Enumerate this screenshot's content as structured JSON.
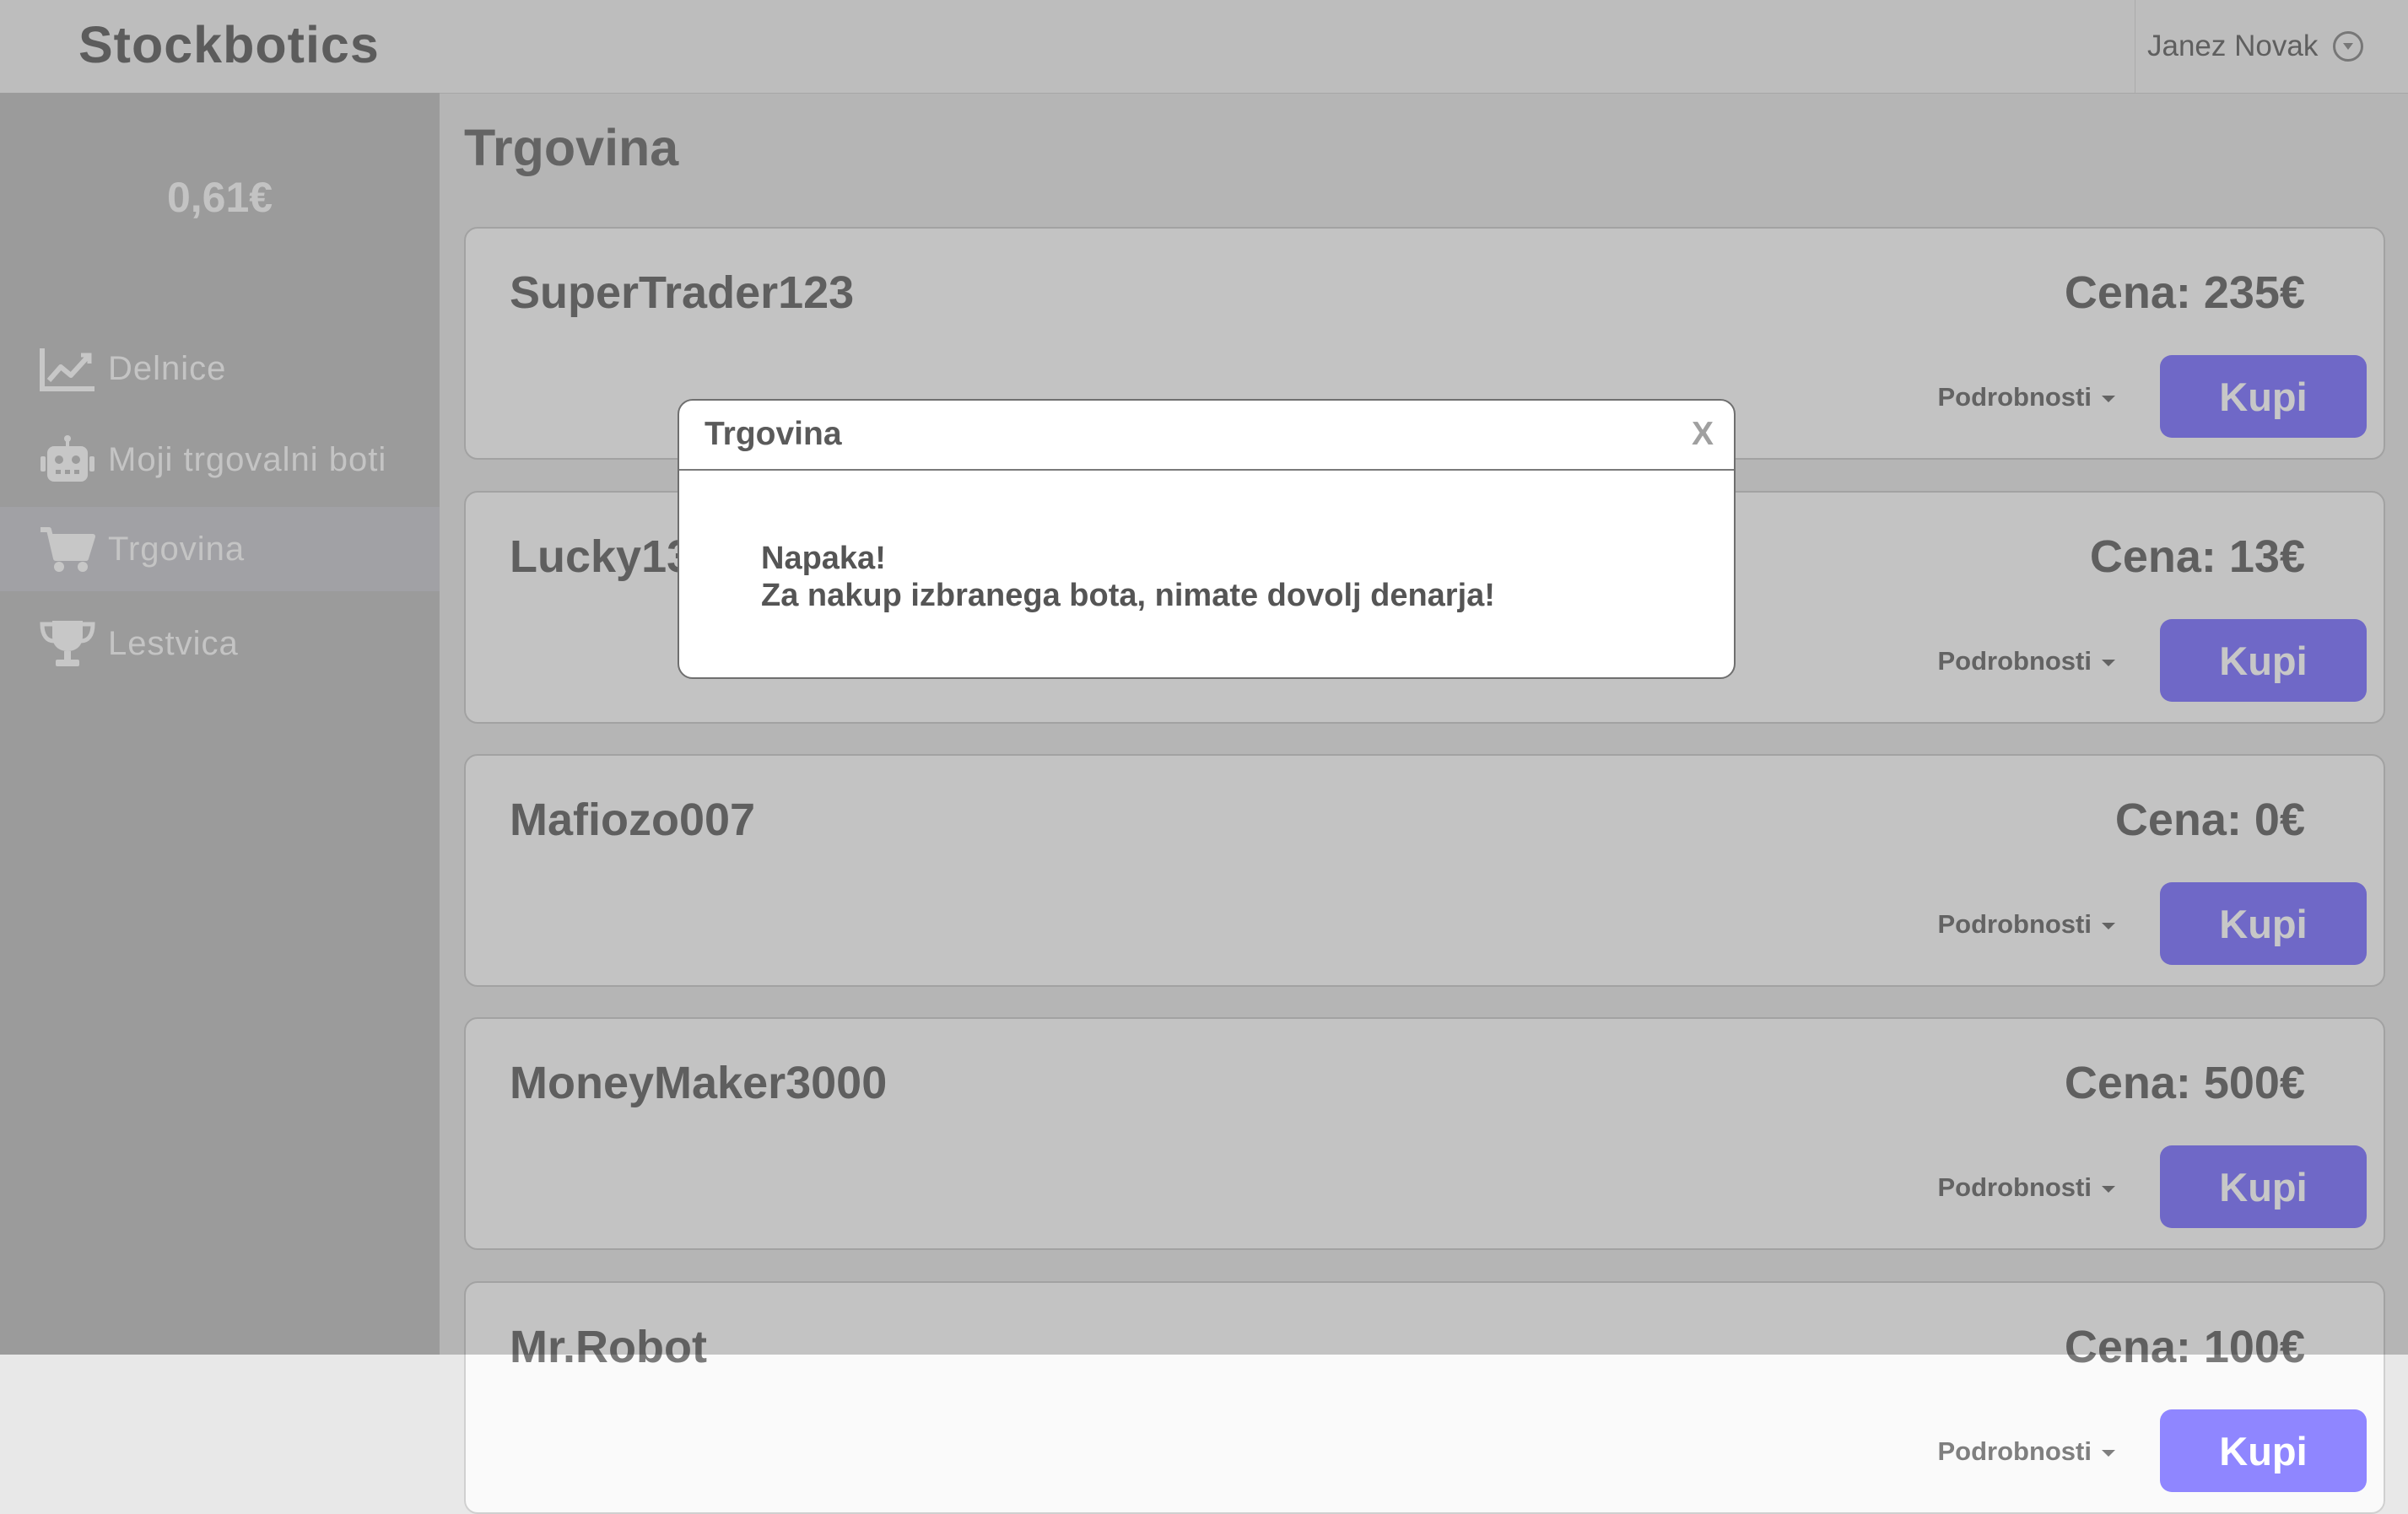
{
  "app": {
    "brand": "Stockbotics",
    "user_name": "Janez Novak"
  },
  "sidebar": {
    "balance": "0,61€",
    "items": [
      {
        "label": "Delnice",
        "icon": "chart-line-icon"
      },
      {
        "label": "Moji trgovalni boti",
        "icon": "robot-icon"
      },
      {
        "label": "Trgovina",
        "icon": "cart-icon",
        "active": true
      },
      {
        "label": "Lestvica",
        "icon": "trophy-icon"
      }
    ]
  },
  "main": {
    "title": "Trgovina",
    "bots": [
      {
        "name": "SuperTrader123",
        "price": "Cena: 235€",
        "details": "Podrobnosti",
        "buy": "Kupi"
      },
      {
        "name": "Lucky13",
        "price": "Cena: 13€",
        "details": "Podrobnosti",
        "buy": "Kupi"
      },
      {
        "name": "Mafiozo007",
        "price": "Cena: 0€",
        "details": "Podrobnosti",
        "buy": "Kupi"
      },
      {
        "name": "MoneyMaker3000",
        "price": "Cena: 500€",
        "details": "Podrobnosti",
        "buy": "Kupi"
      },
      {
        "name": "Mr.Robot",
        "price": "Cena: 100€",
        "details": "Podrobnosti",
        "buy": "Kupi"
      }
    ]
  },
  "modal": {
    "title": "Trgovina",
    "close": "X",
    "error_title": "Napaka!",
    "error_message": "Za nakup izbranega bota, nimate dovolj denarja!"
  },
  "colors": {
    "accent": "#8f86ff",
    "sidebar": "#c7c7c7"
  }
}
